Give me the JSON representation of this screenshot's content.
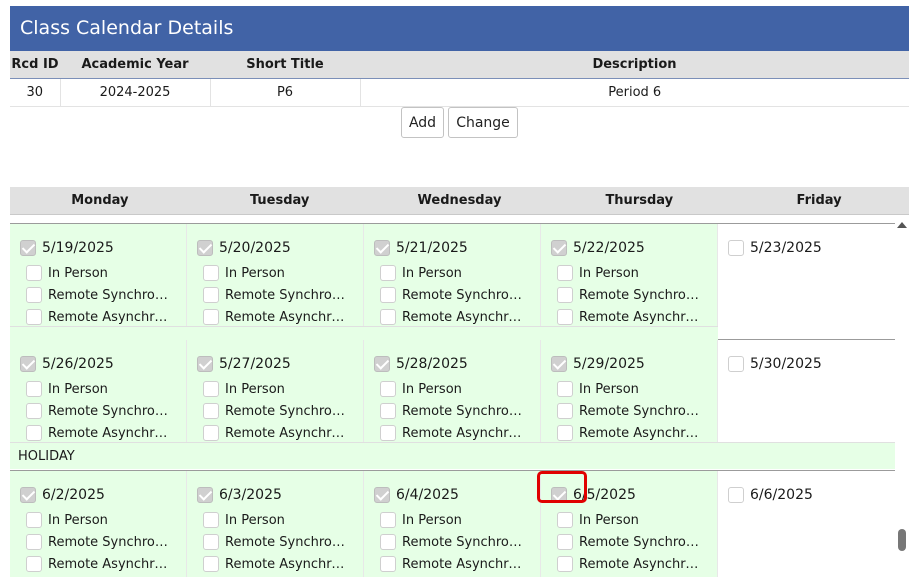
{
  "title": "Class Calendar Details",
  "record_table": {
    "headers": [
      "Rcd ID",
      "Academic Year",
      "Short Title",
      "Description"
    ],
    "row": [
      "30",
      "2024-2025",
      "P6",
      "Period 6"
    ]
  },
  "buttons": {
    "add": "Add",
    "change": "Change"
  },
  "days": [
    "Monday",
    "Tuesday",
    "Wednesday",
    "Thursday",
    "Friday"
  ],
  "options": [
    "In Person",
    "Remote Synchronous",
    "Remote Asynchron..."
  ],
  "weeks": [
    {
      "dates": [
        "5/19/2025",
        "5/20/2025",
        "5/21/2025",
        "5/22/2025",
        "5/23/2025"
      ],
      "checked": [
        true,
        true,
        true,
        true,
        false
      ]
    },
    {
      "dates": [
        "5/26/2025",
        "5/27/2025",
        "5/28/2025",
        "5/29/2025",
        "5/30/2025"
      ],
      "checked": [
        true,
        true,
        true,
        true,
        false
      ]
    },
    {
      "dates": [
        "6/2/2025",
        "6/3/2025",
        "6/4/2025",
        "6/5/2025",
        "6/6/2025"
      ],
      "checked": [
        true,
        true,
        true,
        true,
        false
      ]
    }
  ],
  "holiday_label": "HOLIDAY",
  "colors": {
    "header_blue": "#4163a6",
    "active_green": "#e6ffe6",
    "highlight_red": "#e00000"
  }
}
